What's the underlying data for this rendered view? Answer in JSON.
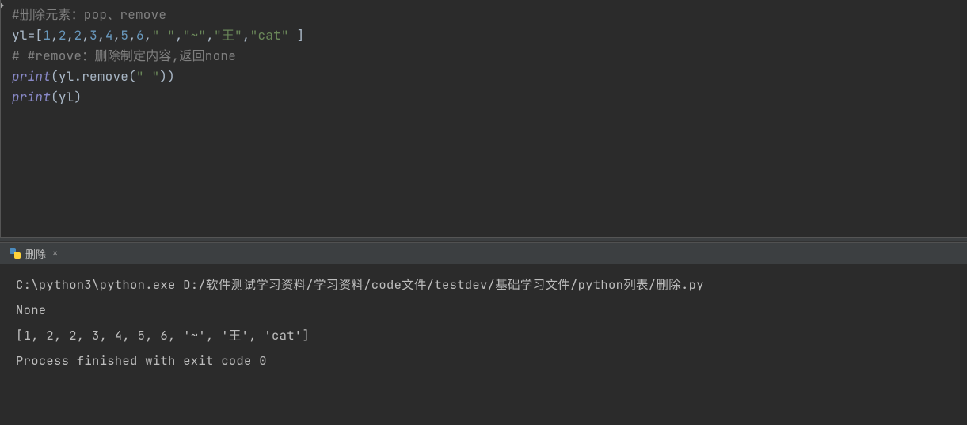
{
  "editor": {
    "lines": {
      "l1_comment": "#删除元素：pop、remove",
      "l2_var": "yl",
      "l2_eq": "=",
      "l2_lb": "[",
      "l2_n1": "1",
      "l2_c1": ",",
      "l2_n2": "2",
      "l2_c2": ",",
      "l2_n3": "2",
      "l2_c3": ",",
      "l2_n4": "3",
      "l2_c4": ",",
      "l2_n5": "4",
      "l2_c5": ",",
      "l2_n6": "5",
      "l2_c6": ",",
      "l2_n7": "6",
      "l2_c7": ",",
      "l2_s1": "\" \"",
      "l2_c8": ",",
      "l2_s2": "\"~\"",
      "l2_c9": ",",
      "l2_s3": "\"王\"",
      "l2_c10": ",",
      "l2_s4": "\"cat\"",
      "l2_sp": " ",
      "l2_rb": "]",
      "l3_comment": "# #remove：删除制定内容,返回none",
      "l4_print": "print",
      "l4_lp": "(",
      "l4_obj": "yl",
      "l4_dot": ".",
      "l4_meth": "remove",
      "l4_lp2": "(",
      "l4_arg": "\" \"",
      "l4_rp2": ")",
      "l4_rp": ")",
      "l5_print": "print",
      "l5_lp": "(",
      "l5_obj": "yl",
      "l5_rp": ")"
    }
  },
  "run_tab": {
    "title": "删除",
    "close_glyph": "×"
  },
  "console": {
    "cmd": "C:\\python3\\python.exe D:/软件测试学习资料/学习资料/code文件/testdev/基础学习文件/python列表/删除.py",
    "out1": "None",
    "out2": "[1, 2, 2, 3, 4, 5, 6, '~', '王', 'cat']",
    "blank": "",
    "exit": "Process finished with exit code 0"
  }
}
